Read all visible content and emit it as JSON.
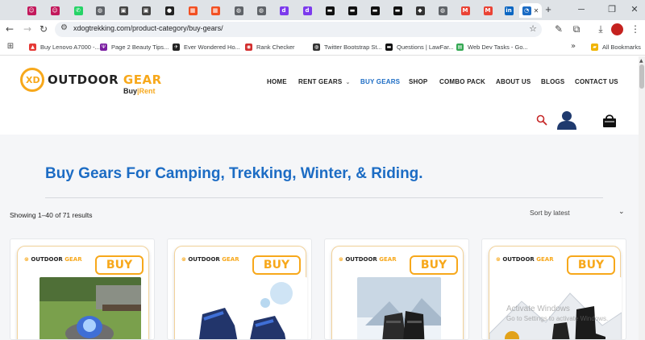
{
  "browser": {
    "tabs": [
      {
        "icon": "recipe-tab-icon",
        "color": "#c2185b",
        "glyph": "☺"
      },
      {
        "icon": "recipe-tab-icon",
        "color": "#c2185b",
        "glyph": "☺"
      },
      {
        "icon": "whatsapp-tab-icon",
        "color": "#25d366",
        "glyph": "✆"
      },
      {
        "icon": "globe-tab-icon",
        "color": "#5f6368",
        "glyph": "◍"
      },
      {
        "icon": "square-tab-icon",
        "color": "#444",
        "glyph": "▣"
      },
      {
        "icon": "square-tab-icon",
        "color": "#444",
        "glyph": "▣"
      },
      {
        "icon": "github-tab-icon",
        "color": "#222",
        "glyph": "●"
      },
      {
        "icon": "windows-tab-icon",
        "color": "#f25022",
        "glyph": "▦"
      },
      {
        "icon": "windows-tab-icon",
        "color": "#f25022",
        "glyph": "▦"
      },
      {
        "icon": "globe-tab-icon",
        "color": "#5f6368",
        "glyph": "◍"
      },
      {
        "icon": "globe-tab-icon",
        "color": "#5f6368",
        "glyph": "◍"
      },
      {
        "icon": "d-tab-icon",
        "color": "#7c3aed",
        "glyph": "d"
      },
      {
        "icon": "d-tab-icon",
        "color": "#7c3aed",
        "glyph": "d"
      },
      {
        "icon": "dark-tab-icon",
        "color": "#111",
        "glyph": "▬"
      },
      {
        "icon": "dark-tab-icon",
        "color": "#111",
        "glyph": "▬"
      },
      {
        "icon": "dark-tab-icon",
        "color": "#111",
        "glyph": "▬"
      },
      {
        "icon": "dark-tab-icon",
        "color": "#111",
        "glyph": "▬"
      },
      {
        "icon": "diamond-tab-icon",
        "color": "#333",
        "glyph": "◆"
      },
      {
        "icon": "globe-tab-icon",
        "color": "#5f6368",
        "glyph": "◍"
      },
      {
        "icon": "gmail-tab-icon",
        "color": "#ea4335",
        "glyph": "M"
      },
      {
        "icon": "gmail-tab-icon",
        "color": "#ea4335",
        "glyph": "M"
      },
      {
        "icon": "linkedin-tab-icon",
        "color": "#0a66c2",
        "glyph": "in"
      },
      {
        "icon": "active-tab-icon",
        "color": "#1c6cc4",
        "glyph": "◔",
        "active": true
      }
    ],
    "address": {
      "url": "xdogtrekking.com/product-category/buy-gears/"
    },
    "bookmarks": [
      {
        "label": "Buy Lenovo A7000 -...",
        "icon_color": "#e53935",
        "glyph": "▲"
      },
      {
        "label": "Page 2 Beauty Tips...",
        "icon_color": "#7b1fa2",
        "glyph": "Ψ"
      },
      {
        "label": "Ever Wondered Ho...",
        "icon_color": "#222",
        "glyph": "✈"
      },
      {
        "label": "Rank Checker",
        "icon_color": "#d32f2f",
        "glyph": "◉"
      },
      {
        "label": "Twitter Bootstrap St...",
        "icon_color": "#333",
        "glyph": "◍"
      },
      {
        "label": "Questions | LawFar...",
        "icon_color": "#111",
        "glyph": "▬"
      },
      {
        "label": "Web Dev Tasks - Go...",
        "icon_color": "#34a853",
        "glyph": "▤"
      }
    ],
    "all_bookmarks_label": "All Bookmarks"
  },
  "site": {
    "logo": {
      "mark": "XD",
      "word1": "OUTDOOR",
      "word2": "GEAR",
      "sub_buy": "Buy",
      "sub_sep": "|",
      "sub_rent": "Rent"
    },
    "nav": [
      {
        "label": "HOME"
      },
      {
        "label": "RENT GEARS",
        "has_dropdown": true
      },
      {
        "label": "BUY GEARS",
        "current": true
      },
      {
        "label": "SHOP"
      },
      {
        "label": "COMBO PACK"
      },
      {
        "label": "ABOUT US"
      },
      {
        "label": "BLOGS"
      },
      {
        "label": "CONTACT US"
      }
    ],
    "colors": {
      "accent": "#f7a81b",
      "link": "#1c6cc4",
      "user_icon": "#1f3a6e"
    }
  },
  "category": {
    "title": "Buy Gears For Camping, Trekking, Winter, & Riding.",
    "result_count": "Showing 1–40 of 71 results",
    "sort_selected": "Sort by latest"
  },
  "products": [
    {
      "badge": "BUY",
      "brand1": "OUTDOOR",
      "brand2": "GEAR",
      "image": "camping-stove-photo"
    },
    {
      "badge": "BUY",
      "brand1": "OUTDOOR",
      "brand2": "GEAR",
      "image": "blue-trekking-boots-photo"
    },
    {
      "badge": "BUY",
      "brand1": "OUTDOOR",
      "brand2": "GEAR",
      "image": "winter-gloves-photo"
    },
    {
      "badge": "BUY",
      "brand1": "OUTDOOR",
      "brand2": "GEAR",
      "image": "black-riding-boots-photo"
    }
  ],
  "watermark": {
    "line1": "Activate Windows",
    "line2": "Go to Settings to activate Windows."
  }
}
